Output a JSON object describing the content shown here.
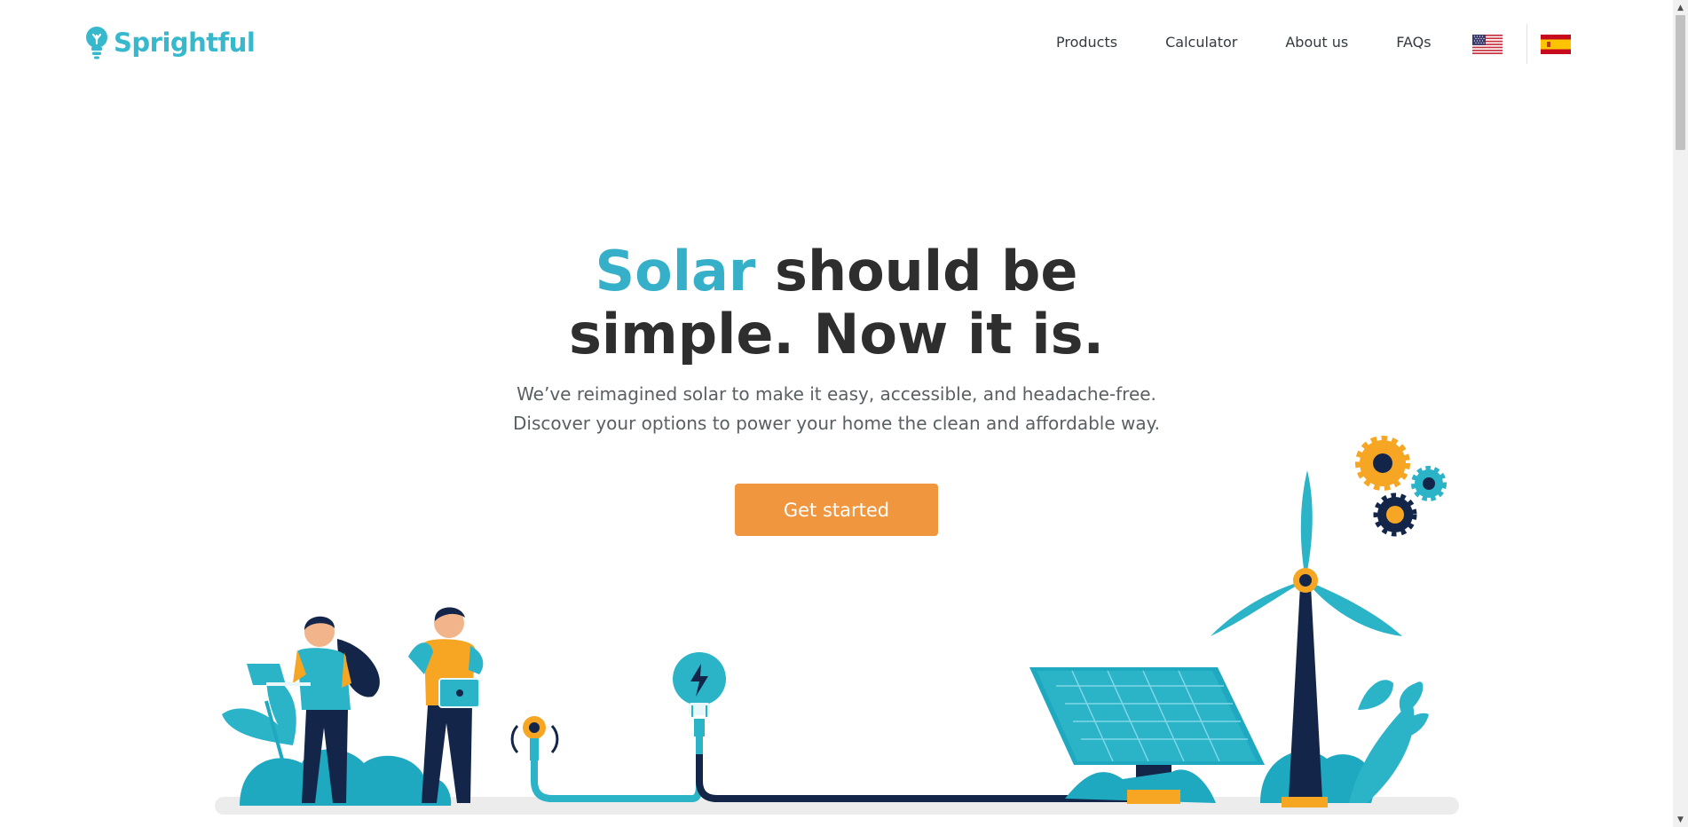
{
  "header": {
    "brand": "Sprightful",
    "nav": [
      {
        "label": "Products"
      },
      {
        "label": "Calculator"
      },
      {
        "label": "About us"
      },
      {
        "label": "FAQs"
      }
    ],
    "languages": [
      "us-flag-icon",
      "spain-flag-icon"
    ]
  },
  "hero": {
    "title_accent": "Solar",
    "title_rest_line1": " should be",
    "title_line2": "simple. Now it is.",
    "subtitle_line1": "We’ve reimagined solar to make it easy, accessible, and headache-free.",
    "subtitle_line2": "Discover your options to power your home the clean and affordable way.",
    "cta_label": "Get started"
  },
  "colors": {
    "brand": "#36b9cc",
    "accent_title": "#36b0c9",
    "cta": "#f0963e",
    "heading": "#2e2e2e",
    "navy": "#13264a",
    "orange": "#f6a623"
  },
  "illustration": {
    "icons": [
      "people-with-laptops",
      "socket-icon",
      "lightbulb-icon",
      "solar-panel",
      "wind-turbine",
      "gears-icon",
      "plants"
    ]
  }
}
